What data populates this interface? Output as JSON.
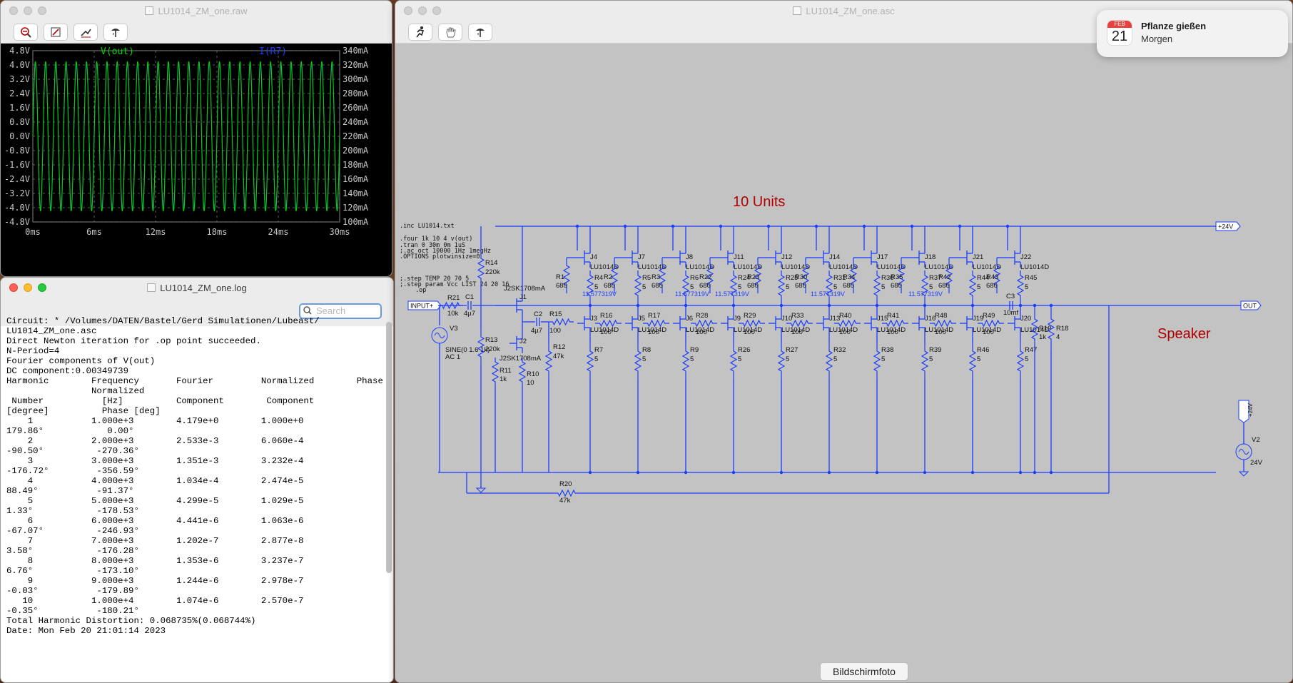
{
  "colors": {
    "trace_v": "#00d400",
    "trace_i": "#1a3cff",
    "wire": "#1a3cff",
    "red": "#b00000",
    "bg_plot": "#000000",
    "bg_sch": "#c3c3c3"
  },
  "waveform": {
    "title": "LU1014_ZM_one.raw",
    "toolbar_icons": [
      "zoom-out-icon",
      "zoom-extents-icon",
      "autorange-icon",
      "probe-icon"
    ],
    "trace_v_label": "V(out)",
    "trace_i_label": "I(R7)",
    "y_left_ticks": [
      "4.8V",
      "4.0V",
      "3.2V",
      "2.4V",
      "1.6V",
      "0.8V",
      "0.0V",
      "-0.8V",
      "-1.6V",
      "-2.4V",
      "-3.2V",
      "-4.0V",
      "-4.8V"
    ],
    "y_right_ticks": [
      "340mA",
      "320mA",
      "300mA",
      "280mA",
      "260mA",
      "240mA",
      "220mA",
      "200mA",
      "180mA",
      "160mA",
      "140mA",
      "120mA",
      "100mA"
    ],
    "x_ticks": [
      "0ms",
      "6ms",
      "12ms",
      "18ms",
      "24ms",
      "30ms"
    ]
  },
  "chart_data": {
    "type": "line",
    "xlabel": "",
    "x_range_ms": [
      0,
      30
    ],
    "series": [
      {
        "name": "V(out)",
        "frequency_hz": 1000,
        "amplitude_v": 4.18,
        "ylim": [
          -4.8,
          4.8
        ]
      },
      {
        "name": "I(R7)",
        "frequency_hz": 1000,
        "center_ma": 220,
        "amplitude_ma": 100,
        "ylim": [
          100,
          340
        ]
      }
    ],
    "grid": true
  },
  "log": {
    "title": "LU1014_ZM_one.log",
    "search_placeholder": "Search",
    "lines": [
      "Circuit: * /Volumes/DATEN/Bastel/Gerd Simulationen/Lubeast/",
      "LU1014_ZM_one.asc",
      "",
      "Direct Newton iteration for .op point succeeded.",
      "N-Period=4",
      "Fourier components of V(out)",
      "DC component:0.00349739",
      "",
      "Harmonic        Frequency       Fourier         Normalized        Phase",
      "                Normalized",
      " Number           [Hz]          Component        Component",
      "[degree]          Phase [deg]",
      "    1           1.000e+3        4.179e+0        1.000e+0",
      "179.86°            0.00°",
      "    2           2.000e+3        2.533e-3        6.060e-4",
      "-90.50°          -270.36°",
      "    3           3.000e+3        1.351e-3        3.232e-4",
      "-176.72°         -356.59°",
      "    4           4.000e+3        1.034e-4        2.474e-5",
      "88.49°           -91.37°",
      "    5           5.000e+3        4.299e-5        1.029e-5",
      "1.33°            -178.53°",
      "    6           6.000e+3        4.441e-6        1.063e-6",
      "-67.07°          -246.93°",
      "    7           7.000e+3        1.202e-7        2.877e-8",
      "3.58°            -176.28°",
      "    8           8.000e+3        1.353e-6        3.237e-7",
      "6.76°            -173.10°",
      "    9           9.000e+3        1.244e-6        2.978e-7",
      "-0.03°           -179.89°",
      "   10           1.000e+4        1.074e-6        2.570e-7",
      "-0.35°           -180.21°",
      "Total Harmonic Distortion: 0.068735%(0.068744%)",
      "",
      "",
      "Date: Mon Feb 20 21:01:14 2023"
    ]
  },
  "schematic": {
    "title": "LU1014_ZM_one.asc",
    "toolbar_icons": [
      "run-icon",
      "hand-icon",
      "probe-icon"
    ],
    "heading": "10 Units",
    "speaker_label": "Speaker",
    "directives": [
      ".inc LU1014.txt",
      ".four 1k 10 4 v(out)",
      ".tran 0 30m 0m 1uS",
      ";.ac oct 10000 1Hz 1megHz",
      ".OPTIONS plotwinsize=0",
      ";.step TEMP 20 70 5",
      ";.step param Vcc LIST 24 20 16",
      ".op"
    ],
    "ports": {
      "input": "INPUT+",
      "out": "OUT",
      "vplus": "+24V"
    },
    "voltage_label": "11.577319V",
    "labels": {
      "R14": "R14",
      "R14v": "220k",
      "R13": "R13",
      "R13v": "220k",
      "R21": "R21",
      "R21v": "10k",
      "C1": "C1",
      "C1v": "4µ7",
      "C2": "C2",
      "C2v": "4µ7",
      "J1": "J1",
      "J1m": "J2SK1708mA",
      "J2": "J2",
      "J2m": "J2SK1708mA",
      "R11": "R11",
      "R11v": "1k",
      "R10": "R10",
      "R10v": "10",
      "R12": "R12",
      "R12v": "47k",
      "R15": "R15",
      "R15v": "100",
      "R20": "R20",
      "R20v": "47k",
      "V3": "V3",
      "V3s": "SINE(0 1.6 1k)",
      "V3ac": "AC 1",
      "C3": "C3",
      "C3v": "10mf",
      "R19": "R19",
      "R19v": "1k",
      "R18": "R18",
      "R18v": "4",
      "V2": "V2",
      "V2v": "24V",
      "V2n": "+24V"
    },
    "units": [
      {
        "jt": "J4",
        "rp": "R1",
        "rs": "R4",
        "jb": "J3",
        "rg": "R16",
        "ro": "R7"
      },
      {
        "jt": "J7",
        "rp": "R2",
        "rs": "R5",
        "jb": "J5",
        "rg": "R17",
        "ro": "R8"
      },
      {
        "jt": "J8",
        "rp": "R3",
        "rs": "R6",
        "jb": "J6",
        "rg": "R28",
        "ro": "R9"
      },
      {
        "jt": "J11",
        "rp": "R22",
        "rs": "R24",
        "jb": "J9",
        "rg": "R29",
        "ro": "R26"
      },
      {
        "jt": "J12",
        "rp": "R23",
        "rs": "R25",
        "jb": "J10",
        "rg": "R33",
        "ro": "R27"
      },
      {
        "jt": "J14",
        "rp": "R30",
        "rs": "R31",
        "jb": "J13",
        "rg": "R40",
        "ro": "R32"
      },
      {
        "jt": "J17",
        "rp": "R34",
        "rs": "R36",
        "jb": "J15",
        "rg": "R41",
        "ro": "R38"
      },
      {
        "jt": "J18",
        "rp": "R35",
        "rs": "R37",
        "jb": "J16",
        "rg": "R48",
        "ro": "R39"
      },
      {
        "jt": "J21",
        "rp": "R42",
        "rs": "R44",
        "jb": "J19",
        "rg": "R49",
        "ro": "R46"
      },
      {
        "jt": "J22",
        "rp": "R43",
        "rs": "R45",
        "jb": "J20",
        "rg": "",
        "ro": "R47"
      }
    ],
    "unit_part": "LU1014D",
    "unit_rp_value": "680",
    "unit_rs_value": "5",
    "unit_rg_value": "100"
  },
  "notification": {
    "month": "FEB",
    "day": "21",
    "title": "Pflanze gießen",
    "subtitle": "Morgen"
  },
  "tooltip": "Bildschirmfoto"
}
